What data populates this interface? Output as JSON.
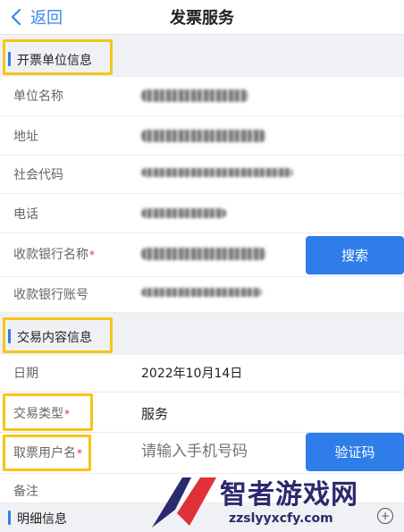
{
  "nav": {
    "back_label": "返回",
    "title": "发票服务"
  },
  "sections": {
    "issuer": "开票单位信息",
    "transaction": "交易内容信息",
    "detail": "明细信息"
  },
  "issuer_fields": {
    "name_label": "单位名称",
    "address_label": "地址",
    "code_label": "社会代码",
    "phone_label": "电话",
    "bank_label": "收款银行名称",
    "account_label": "收款银行账号",
    "search_button": "搜索"
  },
  "transaction_fields": {
    "date_label": "日期",
    "date_value": "2022年10月14日",
    "type_label": "交易类型",
    "type_value": "服务",
    "user_label": "取票用户名",
    "user_placeholder": "请输入手机号码",
    "verify_button": "验证码",
    "note_label": "备注"
  },
  "required_mark": "*",
  "watermark": {
    "brand": "智者游戏网",
    "url": "zzslyyxcfy.com"
  },
  "colors": {
    "accent": "#2f7de9",
    "highlight": "#f5c518",
    "required": "#e0303a"
  }
}
